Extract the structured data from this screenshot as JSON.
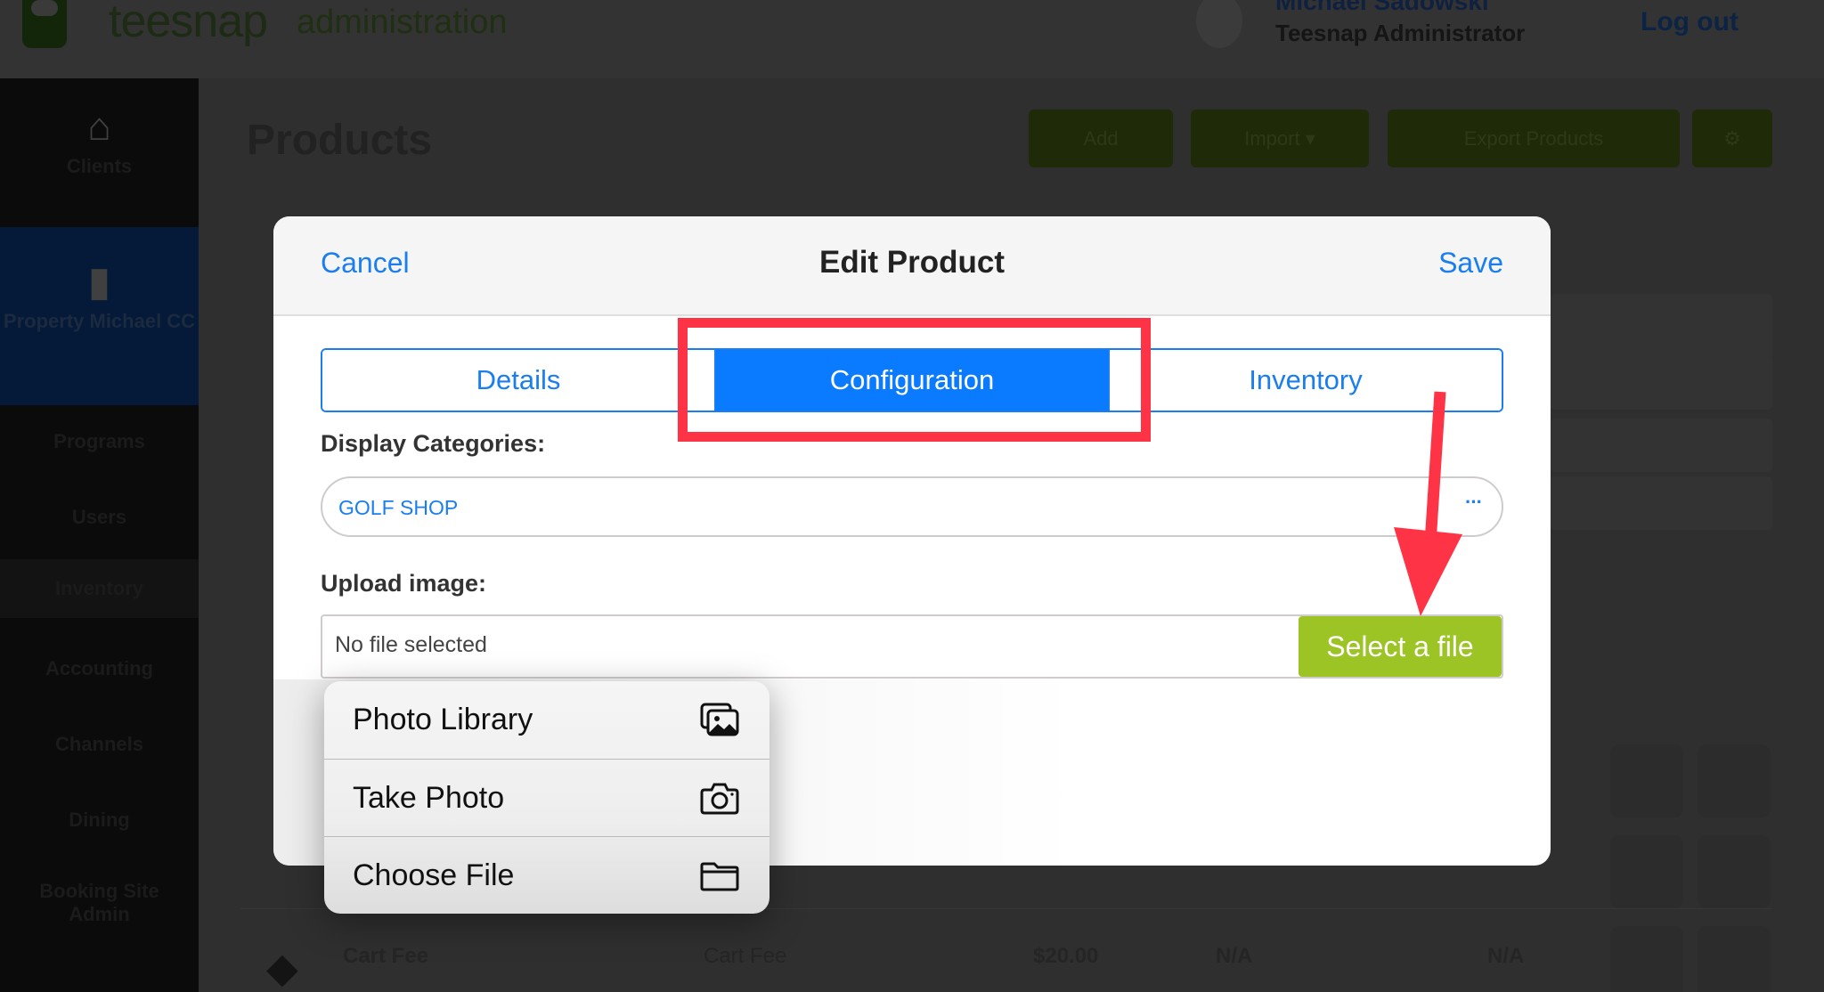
{
  "app": {
    "logo_text": "teesnap",
    "logo_subtitle": "administration",
    "user_name": "Michael Sadowski",
    "user_role": "Teesnap Administrator",
    "logout_label": "Log out"
  },
  "sidebar": {
    "items": [
      {
        "label": "Clients",
        "icon": "home-icon"
      },
      {
        "label": "Property Michael CC",
        "icon": "briefcase-icon",
        "active": true
      },
      {
        "label": "Programs"
      },
      {
        "label": "Users"
      },
      {
        "label": "Inventory"
      },
      {
        "label": "Accounting"
      },
      {
        "label": "Channels"
      },
      {
        "label": "Dining"
      },
      {
        "label": "Booking Site Admin"
      }
    ]
  },
  "page": {
    "title": "Products",
    "buttons": {
      "add": "Add",
      "import": "Import ▾",
      "export": "Export Products"
    },
    "bg_row": {
      "name": "Cart Fee",
      "type": "Cart Fee",
      "price": "$20.00",
      "col2": "N/A",
      "col3": "N/A"
    }
  },
  "modal": {
    "cancel_label": "Cancel",
    "title": "Edit Product",
    "save_label": "Save",
    "tabs": [
      {
        "label": "Details",
        "active": false
      },
      {
        "label": "Configuration",
        "active": true
      },
      {
        "label": "Inventory",
        "active": false
      }
    ],
    "display_categories_label": "Display Categories:",
    "display_categories_value": "GOLF SHOP",
    "display_categories_more": "···",
    "upload_label": "Upload image:",
    "file_status": "No file selected",
    "select_file_label": "Select a file"
  },
  "file_menu": {
    "items": [
      {
        "label": "Photo Library",
        "icon": "photo-library-icon"
      },
      {
        "label": "Take Photo",
        "icon": "camera-icon"
      },
      {
        "label": "Choose File",
        "icon": "folder-icon"
      }
    ]
  },
  "colors": {
    "accent_blue": "#0a7bff",
    "select_green": "#9bc424",
    "annotation_red": "#ff3346"
  }
}
